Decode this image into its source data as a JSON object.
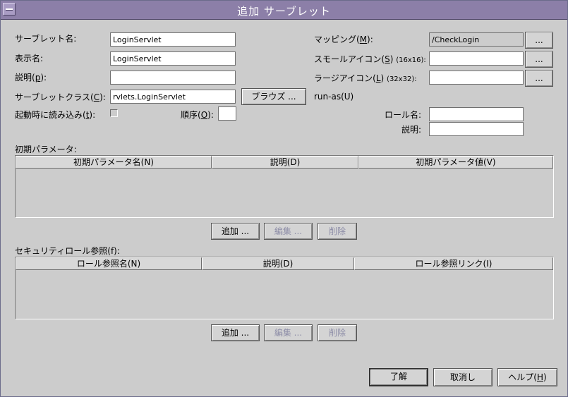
{
  "window": {
    "title": "追加 サーブレット"
  },
  "form": {
    "servlet_name": {
      "label": "サーブレット名:",
      "value": "LoginServlet"
    },
    "display_name": {
      "label": "表示名:",
      "value": "LoginServlet"
    },
    "description": {
      "label_pre": "説明(",
      "mnemonic": "p",
      "label_post": "):",
      "value": ""
    },
    "servlet_class": {
      "label_pre": "サーブレットクラス(",
      "mnemonic": "C",
      "label_post": "):",
      "value": "rvlets.LoginServlet",
      "browse_label": "ブラウズ ..."
    },
    "load_on_startup": {
      "label_pre": "起動時に読み込み(",
      "mnemonic": "t",
      "label_post": "):",
      "checked": false
    },
    "order": {
      "label_pre": "順序(",
      "mnemonic": "O",
      "label_post": "):",
      "value": ""
    },
    "mapping": {
      "label_pre": "マッピング(",
      "mnemonic": "M",
      "label_post": "):",
      "value": "/CheckLogin",
      "button_label": "..."
    },
    "small_icon": {
      "label_pre": "スモールアイコン(",
      "mnemonic": "S",
      "label_post": ")",
      "size_note": "(16x16):",
      "value": "",
      "button_label": "..."
    },
    "large_icon": {
      "label_pre": "ラージアイコン(",
      "mnemonic": "L",
      "label_post": ")",
      "size_note": "(32x32):",
      "value": "",
      "button_label": "..."
    },
    "run_as": {
      "label": "run-as(U)",
      "role_name": {
        "label": "ロール名:",
        "value": ""
      },
      "description": {
        "label": "説明:",
        "value": ""
      }
    }
  },
  "init_params": {
    "section_label": "初期パラメータ:",
    "columns": [
      "初期パラメータ名(N)",
      "説明(D)",
      "初期パラメータ値(V)"
    ],
    "rows": [],
    "buttons": {
      "add": "追加 ...",
      "edit": "編集 ...",
      "delete": "削除"
    }
  },
  "security_roles": {
    "section_label": "セキュリティロール参照(f):",
    "columns": [
      "ロール参照名(N)",
      "説明(D)",
      "ロール参照リンク(I)"
    ],
    "rows": [],
    "buttons": {
      "add": "追加 ...",
      "edit": "編集 ...",
      "delete": "削除"
    }
  },
  "dialog_buttons": {
    "ok": "了解",
    "cancel": "取消し",
    "help_pre": "ヘルプ(",
    "help_mnemonic": "H",
    "help_post": ")"
  },
  "colors": {
    "titlebar": "#8c7fa8",
    "background": "#cccccc",
    "disabled_text": "#8e8ea8"
  }
}
